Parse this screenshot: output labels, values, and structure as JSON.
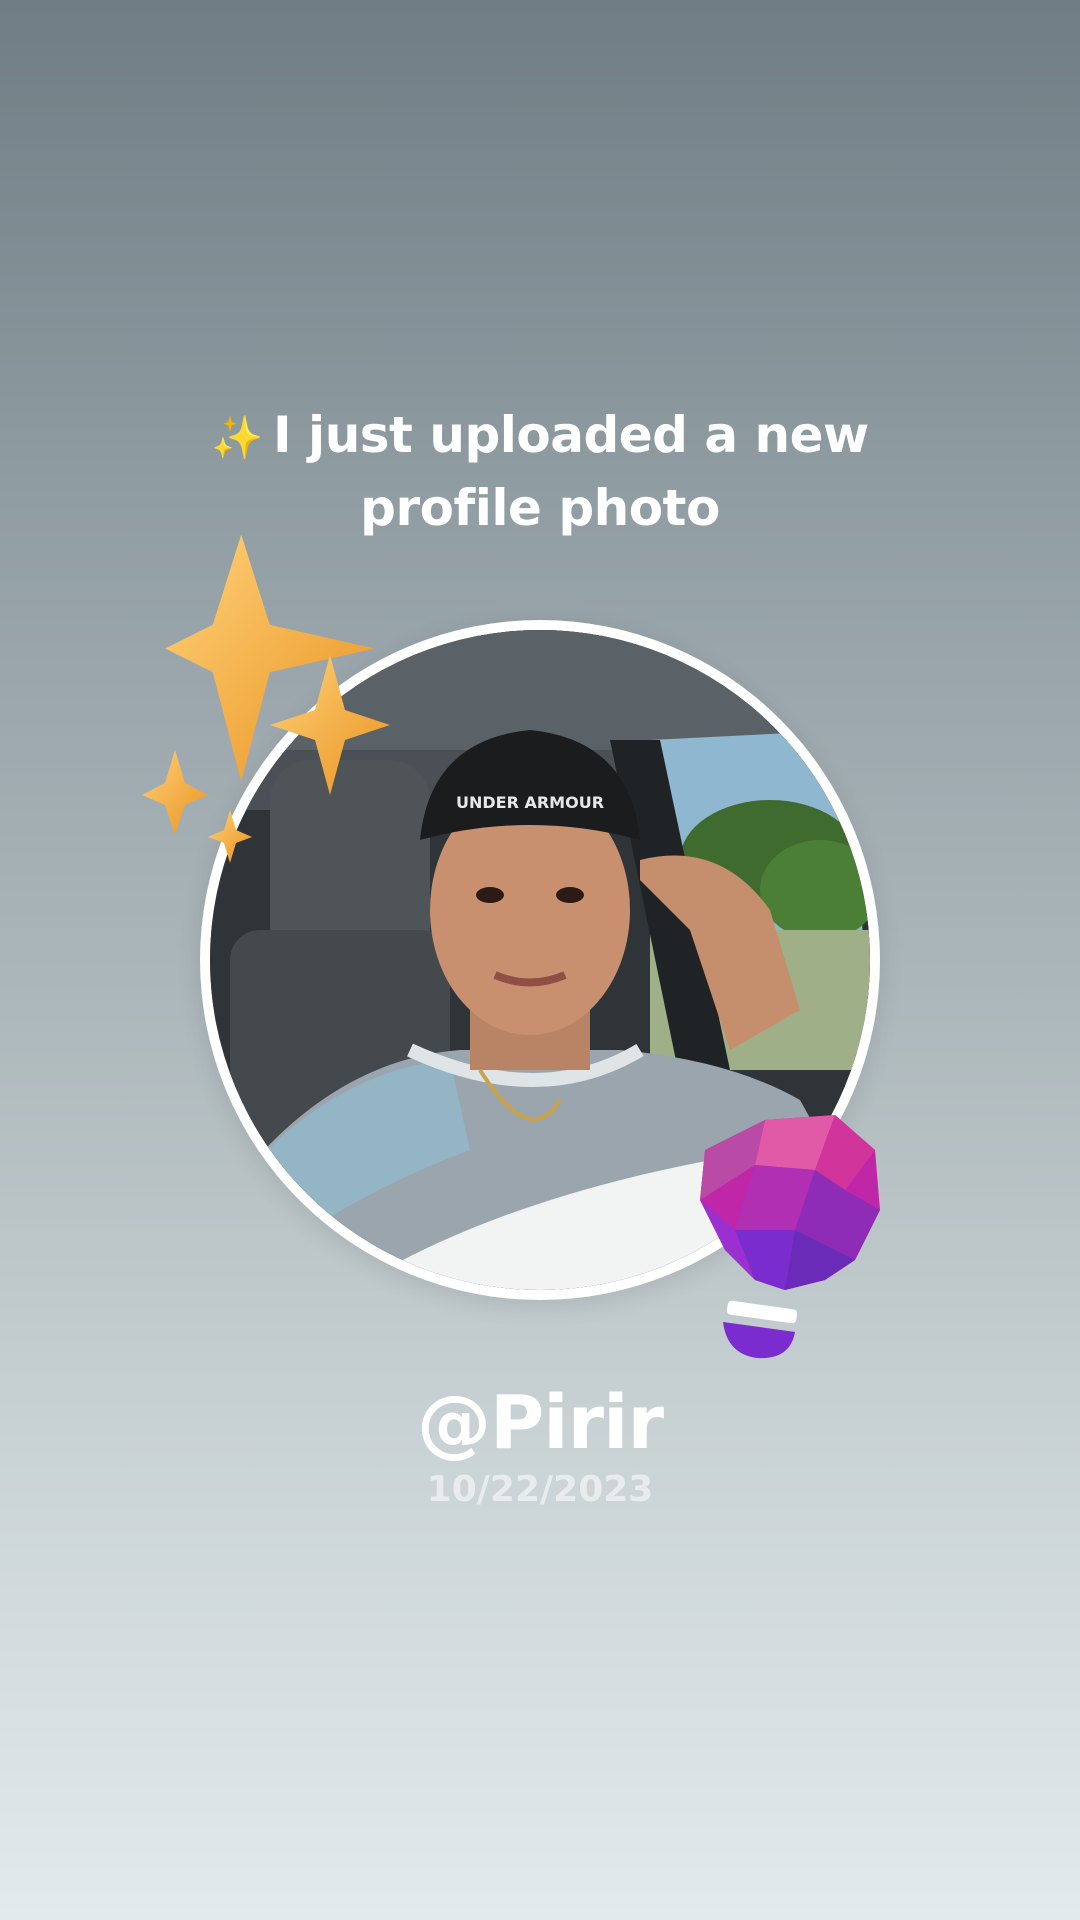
{
  "post": {
    "headline_icon": "sparkles-icon",
    "headline": "I just uploaded a new profile photo",
    "username": "@Pirir",
    "date": "10/22/2023"
  },
  "avatar": {
    "cap_text": "UNDER ARMOUR"
  },
  "colors": {
    "background_top": "#6f7d84",
    "background_bottom": "#e3eaec",
    "star_gold": "#f4b33a",
    "bulb_purple": "#9b2fd0",
    "text": "#ffffff"
  },
  "decorations": [
    "gold-stars-sticker",
    "purple-lightbulb-sticker"
  ]
}
